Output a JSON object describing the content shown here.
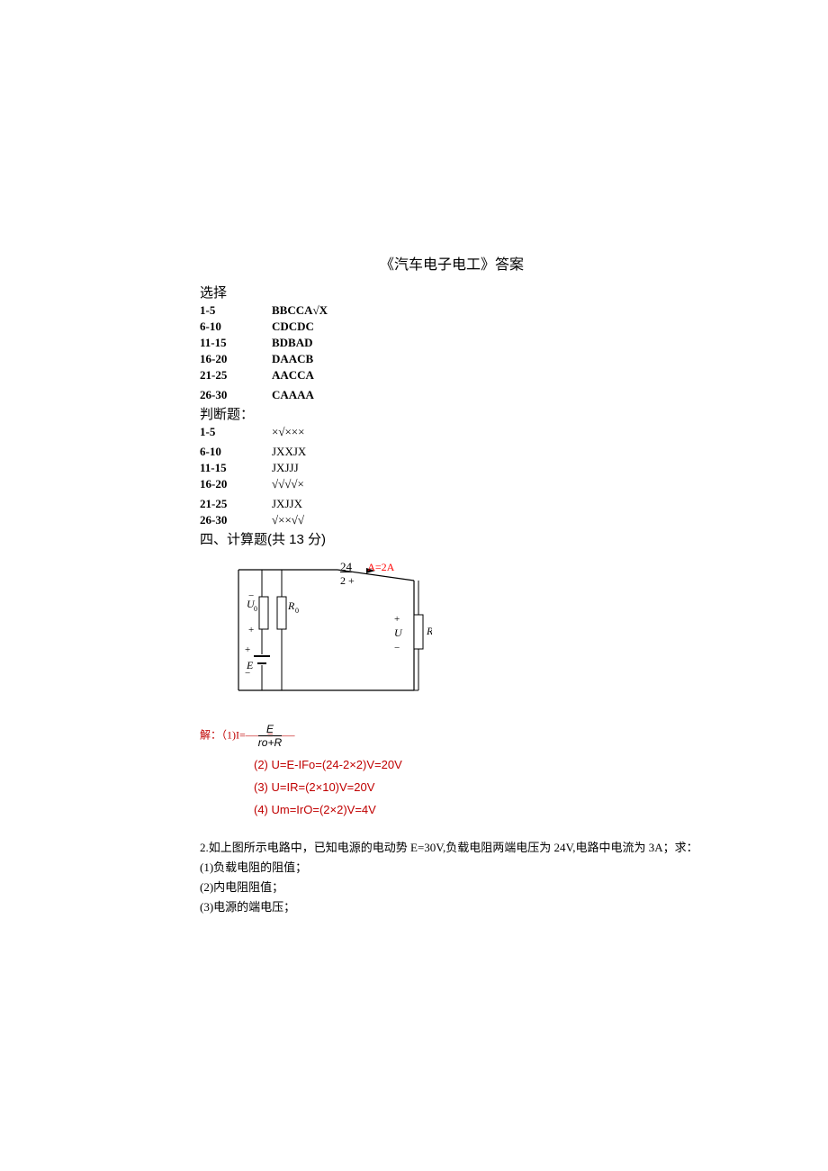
{
  "title": "《汽车电子电工》答案",
  "choice_label": "选择",
  "choice_rows": [
    {
      "range": "1-5",
      "ans": "BBCCA√X"
    },
    {
      "range": "6-10",
      "ans": "CDCDC"
    },
    {
      "range": "11-15",
      "ans": "BDBAD"
    },
    {
      "range": "16-20",
      "ans": "DAACB"
    },
    {
      "range": "21-25",
      "ans": "AACCA"
    },
    {
      "range": "26-30",
      "ans": "CAAAA"
    }
  ],
  "judge_label": "判断题：",
  "judge_rows": [
    {
      "range": "1-5",
      "ans": "×√×××"
    },
    {
      "range": "6-10",
      "ans": "JXXJX"
    },
    {
      "range": "11-15",
      "ans": "JXJJJ"
    },
    {
      "range": "16-20",
      "ans": "√√√√×"
    },
    {
      "range": "21-25",
      "ans": "JXJJX"
    },
    {
      "range": "26-30",
      "ans": "√××√√"
    }
  ],
  "calc_title": "四、计算题(共 13 分)",
  "diagram_labels": {
    "top_num": "24",
    "top_right": "A=2A",
    "top_den": "2 +",
    "u0": "U₀",
    "r0": "R₀",
    "e": "E",
    "u": "U",
    "r": "R",
    "plus": "+",
    "minus": "−"
  },
  "solution_prefix": "解：（1)I=——=——",
  "solution_formula": "ro+R",
  "solution_e": "E",
  "sol2": "(2)    U=E-IFo=(24-2×2)V=20V",
  "sol3": "(3)     U=IR=(2×10)V=20V",
  "sol4": "(4)     Um=IrO=(2×2)V=4V",
  "q2_stem": "2.如上图所示电路中，已知电源的电动势 E=30V,负载电阻两端电压为 24V,电路中电流为 3A；求：",
  "q2_1": "(1)负载电阻的阻值；",
  "q2_2": "(2)内电阻阻值；",
  "q2_3": "(3)电源的端电压；"
}
